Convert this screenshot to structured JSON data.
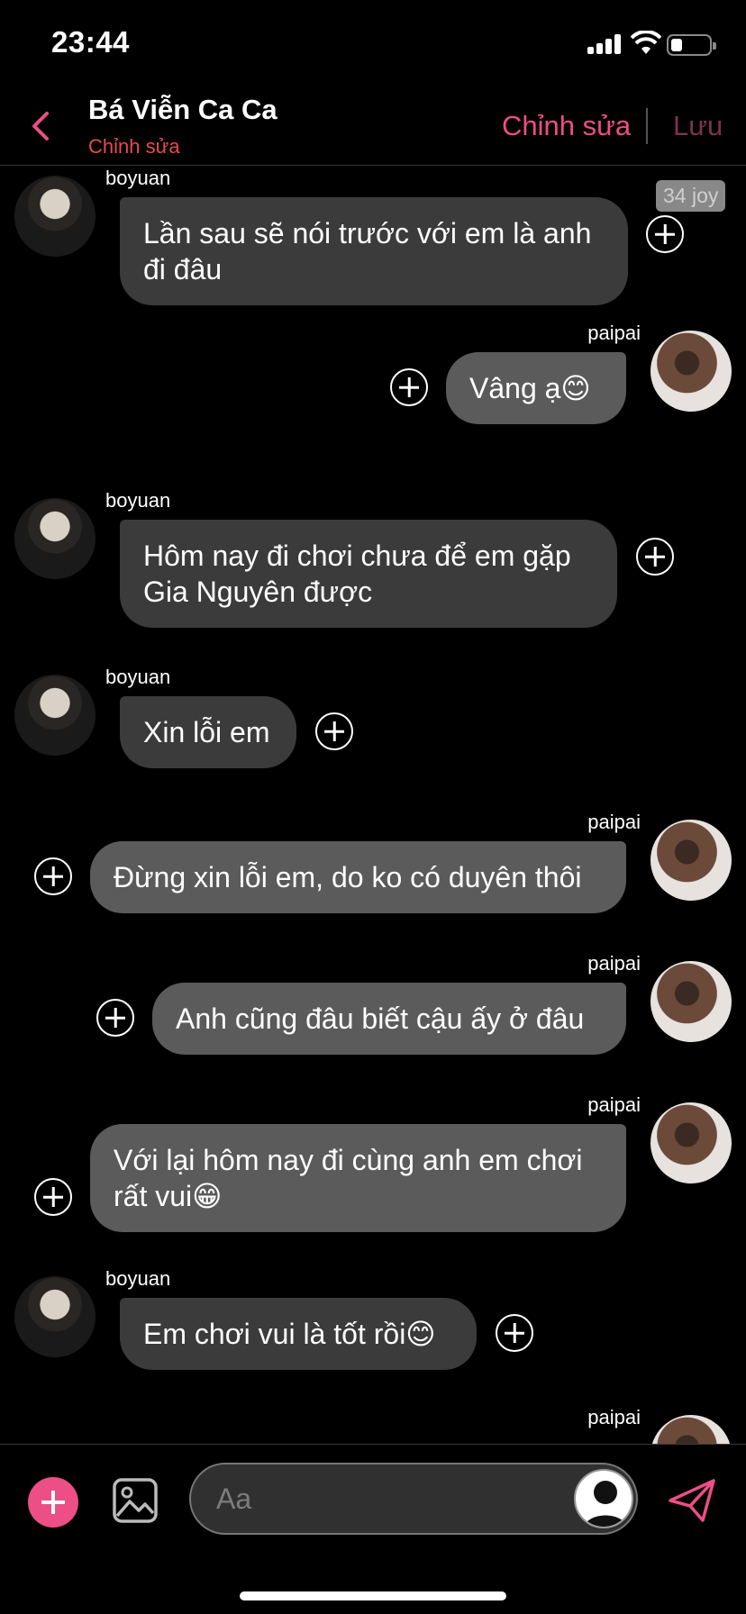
{
  "status_bar": {
    "time": "23:44"
  },
  "header": {
    "title": "Bá Viễn Ca Ca",
    "subtitle": "Chỉnh sửa",
    "edit_label": "Chỉnh sửa",
    "save_label": "Lưu"
  },
  "messages": [
    {
      "sender": "boyuan",
      "side": "left",
      "text": "Lần sau sẽ nói trước với em là anh đi đâu",
      "timestamp": "34 joy"
    },
    {
      "sender": "paipai",
      "side": "right",
      "text": "Vâng ạ😊"
    },
    {
      "sender": "boyuan",
      "side": "left",
      "text": "Hôm nay đi chơi chưa để em gặp Gia Nguyên được"
    },
    {
      "sender": "boyuan",
      "side": "left",
      "text": "Xin lỗi em"
    },
    {
      "sender": "paipai",
      "side": "right",
      "text": "Đừng xin lỗi em, do ko có duyên thôi"
    },
    {
      "sender": "paipai",
      "side": "right",
      "text": "Anh cũng đâu biết cậu ấy ở đâu"
    },
    {
      "sender": "paipai",
      "side": "right",
      "text": "Với lại hôm nay đi cùng anh em chơi rất vui😁"
    },
    {
      "sender": "boyuan",
      "side": "left",
      "text": "Em chơi vui là tốt rồi😊"
    },
    {
      "sender": "paipai",
      "side": "right",
      "text": ""
    }
  ],
  "input": {
    "placeholder": "Aa"
  },
  "colors": {
    "accent": "#ec4e86",
    "subtitle": "#e84a50",
    "bubble_in": "#3b3b3b",
    "bubble_out": "#5b5b5b"
  },
  "icons": [
    "back-chevron-icon",
    "plus-circle-icon",
    "image-icon",
    "person-icon",
    "send-icon"
  ]
}
